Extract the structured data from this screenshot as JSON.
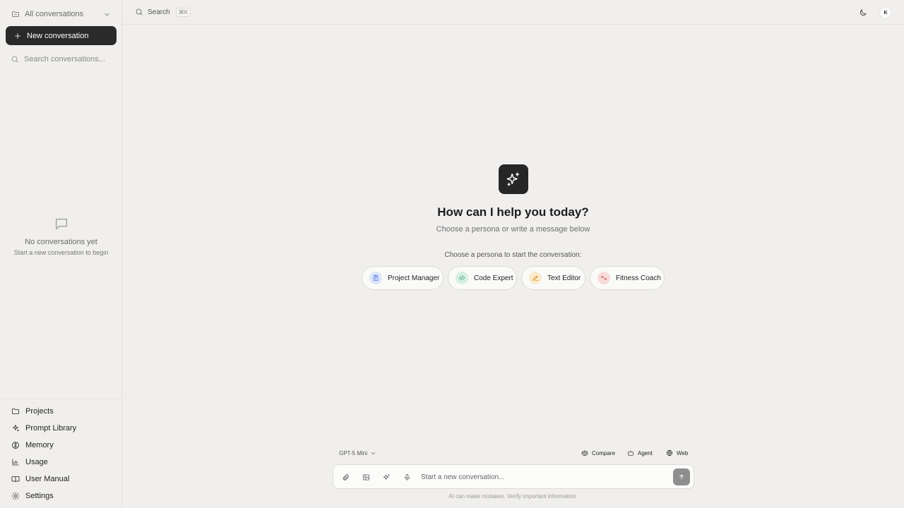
{
  "sidebar": {
    "filter_label": "All conversations",
    "new_conversation_label": "New conversation",
    "search_placeholder": "Search conversations...",
    "empty_title": "No conversations yet",
    "empty_subtitle": "Start a new conversation to begin",
    "nav": [
      {
        "label": "Projects",
        "icon": "folder-icon"
      },
      {
        "label": "Prompt Library",
        "icon": "sparkles-icon"
      },
      {
        "label": "Memory",
        "icon": "brain-icon"
      },
      {
        "label": "Usage",
        "icon": "bar-chart-icon"
      },
      {
        "label": "User Manual",
        "icon": "book-icon"
      },
      {
        "label": "Settings",
        "icon": "gear-icon"
      }
    ]
  },
  "topbar": {
    "search_label": "Search",
    "search_shortcut": "⌘K",
    "avatar_initial": "K"
  },
  "hero": {
    "title": "How can I help you today?",
    "subtitle": "Choose a persona or write a message below",
    "persona_prompt": "Choose a persona to start the conversation:",
    "personas": [
      {
        "label": "Project Manager",
        "icon": "clipboard-icon",
        "color": "#4a6fd8",
        "bg": "#dde6fb"
      },
      {
        "label": "Code Expert",
        "icon": "code-icon",
        "color": "#2e9a6a",
        "bg": "#d7f0e3"
      },
      {
        "label": "Text Editor",
        "icon": "pencil-icon",
        "color": "#d08a1e",
        "bg": "#fbeacb"
      },
      {
        "label": "Fitness Coach",
        "icon": "dumbbell-icon",
        "color": "#d04848",
        "bg": "#f8dcdc"
      }
    ]
  },
  "composer": {
    "model": "GPT-5 Mini",
    "tools": [
      "Compare",
      "Agent",
      "Web"
    ],
    "placeholder": "Start a new conversation...",
    "disclaimer": "AI can make mistakes. Verify important information."
  }
}
